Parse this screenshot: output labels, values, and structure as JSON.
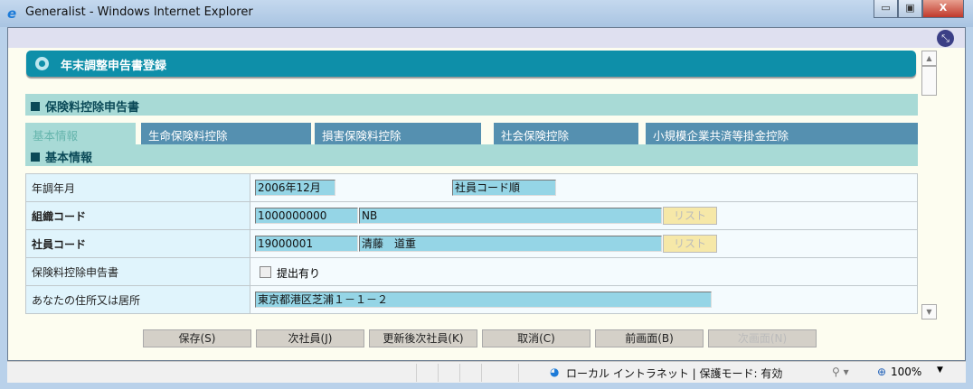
{
  "window": {
    "title": "Generalist - Windows Internet Explorer",
    "minimize": "▭",
    "maximize": "▣",
    "close": "X"
  },
  "header": {
    "title": "年末調整申告書登録"
  },
  "section1": {
    "title": "保険料控除申告書"
  },
  "tabs": [
    {
      "label": "基本情報",
      "active": true
    },
    {
      "label": "生命保険料控除"
    },
    {
      "label": "損害保険料控除"
    },
    {
      "label": "社会保険控除"
    },
    {
      "label": "小規模企業共済等掛金控除"
    }
  ],
  "section2": {
    "title": "基本情報"
  },
  "form": {
    "year_month": {
      "label": "年調年月",
      "value": "2006年12月",
      "sort": "社員コード順"
    },
    "org_code": {
      "label": "組織コード",
      "code": "1000000000",
      "name": "NB",
      "list": "リスト"
    },
    "emp_code": {
      "label": "社員コード",
      "code": "19000001",
      "name": "清藤　道重",
      "list": "リスト"
    },
    "insurance": {
      "label": "保険料控除申告書",
      "checkbox_label": "提出有り",
      "checked": false
    },
    "address": {
      "label": "あなたの住所又は居所",
      "value": "東京都港区芝浦１－１－２"
    }
  },
  "buttons": [
    {
      "label": "保存(S)"
    },
    {
      "label": "次社員(J)"
    },
    {
      "label": "更新後次社員(K)"
    },
    {
      "label": "取消(C)"
    },
    {
      "label": "前画面(B)"
    },
    {
      "label": "次画面(N)",
      "disabled": true
    }
  ],
  "status": {
    "zone": "ローカル イントラネット | 保護モード: 有効",
    "zoom": "100%"
  }
}
